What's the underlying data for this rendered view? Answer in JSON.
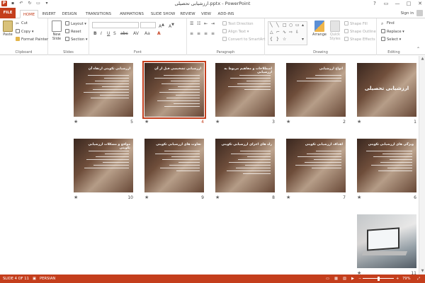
{
  "window": {
    "title": "ارزشیابی تحصیلی.pptx - PowerPoint",
    "app_icon": "P",
    "controls": [
      "?",
      "▭",
      "—",
      "□",
      "✕"
    ]
  },
  "ribbon_tabs": {
    "file": "FILE",
    "items": [
      "HOME",
      "INSERT",
      "DESIGN",
      "TRANSITIONS",
      "ANIMATIONS",
      "SLIDE SHOW",
      "REVIEW",
      "VIEW",
      "ADD-INS"
    ],
    "active": "HOME",
    "signin": "Sign in"
  },
  "ribbon": {
    "clipboard": {
      "label": "Clipboard",
      "paste": "Paste",
      "cut": "Cut",
      "copy": "Copy",
      "format_painter": "Format Painter"
    },
    "slides": {
      "label": "Slides",
      "new_slide": "New Slide",
      "layout": "Layout",
      "reset": "Reset",
      "section": "Section"
    },
    "font": {
      "label": "Font"
    },
    "paragraph": {
      "label": "Paragraph",
      "text_direction": "Text Direction",
      "align_text": "Align Text",
      "convert": "Convert to SmartArt"
    },
    "drawing": {
      "label": "Drawing",
      "arrange": "Arrange",
      "quick_styles": "Quick Styles",
      "shape_fill": "Shape Fill",
      "shape_outline": "Shape Outline",
      "shape_effects": "Shape Effects"
    },
    "editing": {
      "label": "Editing",
      "find": "Find",
      "replace": "Replace",
      "select": "Select"
    }
  },
  "slides": [
    {
      "num": "1",
      "title": "ارزشیابی تحصیلی",
      "lines": 0,
      "center": true
    },
    {
      "num": "2",
      "title": "انواع ارزشیابی",
      "lines": 3
    },
    {
      "num": "3",
      "title": "اصطلاحات و مفاهیم مربوط به ارزشیابی",
      "lines": 6
    },
    {
      "num": "4",
      "title": "ارزشیابی تشخیصی قبل از آن",
      "lines": 12,
      "selected": true
    },
    {
      "num": "5",
      "title": "ارزشیابی تکوینی ارتقاء آن",
      "lines": 9
    },
    {
      "num": "6",
      "title": "ویژگی های ارزشیابی تکوینی",
      "lines": 8
    },
    {
      "num": "7",
      "title": "اهداف ارزشیابی تکوینی",
      "lines": 7
    },
    {
      "num": "8",
      "title": "راه های اجرای ارزشیابی تکوینی",
      "lines": 9
    },
    {
      "num": "9",
      "title": "تفاوت های ارزشیابی تکوینی",
      "lines": 8
    },
    {
      "num": "10",
      "title": "مواقع و مشکلات ارزشیابی تکوینی",
      "lines": 7
    },
    {
      "num": "11",
      "title": "",
      "lines": 0,
      "laptop": true
    }
  ],
  "status": {
    "slide_info": "SLIDE 4 OF 11",
    "language": "PERSIAN",
    "zoom": "79%",
    "zoom_fraction": 0.5
  }
}
